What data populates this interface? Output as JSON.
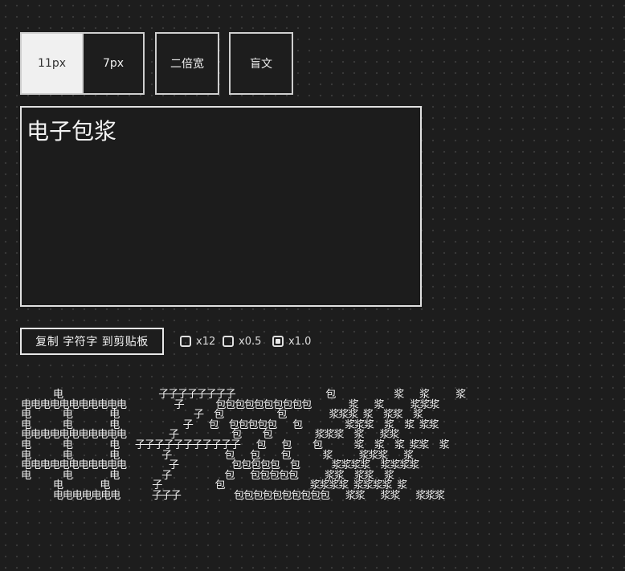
{
  "toolbar": {
    "font_11_label": "11px",
    "font_7_label": "7px",
    "double_width_label": "二倍宽",
    "braille_label": "盲文"
  },
  "editor": {
    "value": "电子包浆"
  },
  "copy_button_label": "复制 字符字 到剪贴板",
  "scale_options": [
    {
      "label": "x12",
      "checked": false
    },
    {
      "label": "x0.5",
      "checked": false
    },
    {
      "label": "x1.0",
      "checked": true
    }
  ],
  "art_output": "      电                  子子子子子子子子                 包           浆   浆     浆\n电电电电电电电电电电电         子      包包包包包包包包包包       浆   浆     浆浆浆\n电      电       电              子  包          包        浆浆浆 浆  浆浆  浆\n电      电       电            子   包  包包包包包   包        浆浆浆  浆  浆 浆浆\n电电电电电电电电电电电        子          包    包        浆浆浆  浆   浆浆\n电      电       电   子子子子子子子子子子子   包   包    包      浆  浆  浆 浆浆  浆\n电      电       电        子          包   包    包      浆     浆浆浆   浆\n电电电电电电电电电电电        子          包包包包包  包      浆浆浆浆  浆浆浆浆\n电      电       电        子          包   包包包包包     浆浆  浆浆  浆\n      电       电        子          包                浆浆浆浆 浆浆浆浆 浆\n      电电电电电电电      子子子          包包包包包包包包包包   浆浆   浆浆   浆浆浆"
}
